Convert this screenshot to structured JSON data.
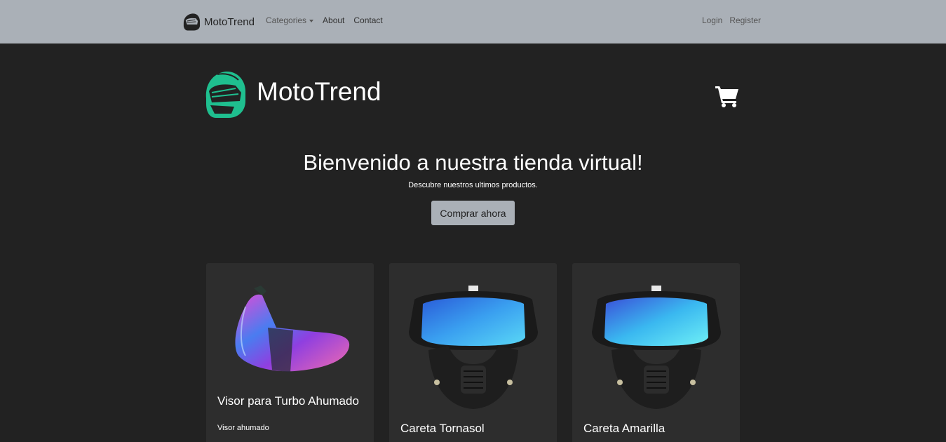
{
  "navbar": {
    "brand": "MotoTrend",
    "links": {
      "categories": "Categories",
      "about": "About",
      "contact": "Contact"
    },
    "auth": {
      "login": "Login",
      "register": "Register"
    }
  },
  "header": {
    "title": "MotoTrend",
    "cart_icon": "shopping-cart-icon"
  },
  "hero": {
    "title": "Bienvenido a nuestra tienda virtual!",
    "subtitle": "Descubre nuestros ultimos productos.",
    "button": "Comprar ahora"
  },
  "products": [
    {
      "title": "Visor para Turbo Ahumado",
      "description": "Visor ahumado"
    },
    {
      "title": "Careta Tornasol"
    },
    {
      "title": "Careta Amarilla"
    }
  ],
  "colors": {
    "navbar_bg": "#aab0b7",
    "page_bg": "#222222",
    "card_bg": "#2d2d2d",
    "logo_accent": "#1fbf8f"
  }
}
